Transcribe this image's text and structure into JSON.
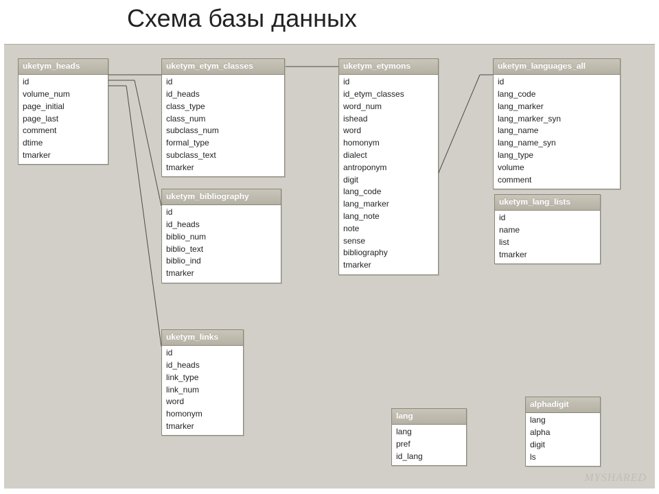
{
  "title": "Схема базы данных",
  "watermark": "MYSHARED",
  "tables": {
    "heads": {
      "name": "uketym_heads",
      "fields": [
        "id",
        "volume_num",
        "page_initial",
        "page_last",
        "comment",
        "dtime",
        "tmarker"
      ]
    },
    "etym_classes": {
      "name": "uketym_etym_classes",
      "fields": [
        "id",
        "id_heads",
        "class_type",
        "class_num",
        "subclass_num",
        "formal_type",
        "subclass_text",
        "tmarker"
      ]
    },
    "etymons": {
      "name": "uketym_etymons",
      "fields": [
        "id",
        "id_etym_classes",
        "word_num",
        "ishead",
        "word",
        "homonym",
        "dialect",
        "antroponym",
        "digit",
        "lang_code",
        "lang_marker",
        "lang_note",
        "note",
        "sense",
        "bibliography",
        "tmarker"
      ]
    },
    "languages_all": {
      "name": "uketym_languages_all",
      "fields": [
        "id",
        "lang_code",
        "lang_marker",
        "lang_marker_syn",
        "lang_name",
        "lang_name_syn",
        "lang_type",
        "volume",
        "comment"
      ]
    },
    "bibliography": {
      "name": "uketym_bibliography",
      "fields": [
        "id",
        "id_heads",
        "biblio_num",
        "biblio_text",
        "biblio_ind",
        "tmarker"
      ]
    },
    "lang_lists": {
      "name": "uketym_lang_lists",
      "fields": [
        "id",
        "name",
        "list",
        "tmarker"
      ]
    },
    "links": {
      "name": "uketym_links",
      "fields": [
        "id",
        "id_heads",
        "link_type",
        "link_num",
        "word",
        "homonym",
        "tmarker"
      ]
    },
    "lang": {
      "name": "lang",
      "fields": [
        "lang",
        "pref",
        "id_lang"
      ]
    },
    "alphadigit": {
      "name": "alphadigit",
      "fields": [
        "lang",
        "alpha",
        "digit",
        "ls"
      ]
    }
  }
}
